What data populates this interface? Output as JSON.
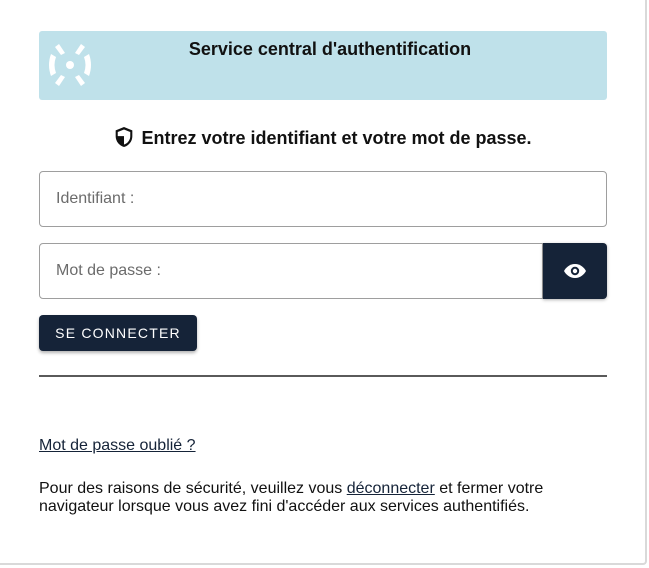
{
  "banner": {
    "title": "Service central d'authentification",
    "logo_icon": "cas-logo-icon",
    "background_color": "#bfe1ea"
  },
  "instruction": {
    "icon": "shield-icon",
    "text": "Entrez votre identifiant et votre mot de passe."
  },
  "form": {
    "username": {
      "placeholder": "Identifiant :",
      "value": ""
    },
    "password": {
      "placeholder": "Mot de passe :",
      "value": ""
    },
    "toggle_password_icon": "eye-icon",
    "submit_label": "SE CONNECTER"
  },
  "links": {
    "forgot_password": "Mot de passe oublié ?"
  },
  "security_note": {
    "before": "Pour des raisons de sécurité, veuillez vous ",
    "link": "déconnecter",
    "after": " et fermer votre navigateur lorsque vous avez fini d'accéder aux services authentifiés."
  },
  "colors": {
    "primary": "#152338",
    "banner": "#bfe1ea",
    "divider": "#5a5a5a"
  }
}
